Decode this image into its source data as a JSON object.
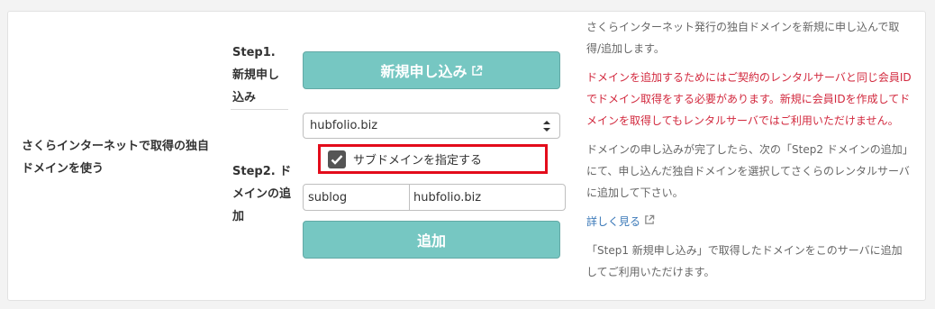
{
  "left_label": "さくらインターネットで取得の独自ドメインを使う",
  "step1": {
    "label": "Step1. 新規申し込み",
    "button_label": "新規申し込み"
  },
  "step2": {
    "label": "Step2. ドメインの追加",
    "selected_domain": "hubfolio.biz",
    "subdomain_checkbox_label": "サブドメインを指定する",
    "subdomain_checked": true,
    "subdomain_value": "sublog",
    "domain_suffix": "hubfolio.biz",
    "add_button_label": "追加"
  },
  "info": {
    "intro": "さくらインターネット発行の独自ドメインを新規に申し込んで取得/追加します。",
    "warning": "ドメインを追加するためにはご契約のレンタルサーバと同じ会員IDでドメイン取得をする必要があります。新規に会員IDを作成してドメインを取得してもレンタルサーバではご利用いただけません。",
    "after": "ドメインの申し込みが完了したら、次の「Step2 ドメインの追加」にて、申し込んだ独自ドメインを選択してさくらのレンタルサーバに追加して下さい。",
    "more_link": "詳しく見る",
    "footer": "「Step1 新規申し込み」で取得したドメインをこのサーバに追加してご利用いただけます。"
  },
  "colors": {
    "button_bg": "#76c7c2",
    "warning_text": "#d2293e",
    "highlight_border": "#e30c1b",
    "link": "#3a78b8"
  },
  "icons": [
    "external-link-icon",
    "select-arrows-icon",
    "checkmark-icon"
  ]
}
